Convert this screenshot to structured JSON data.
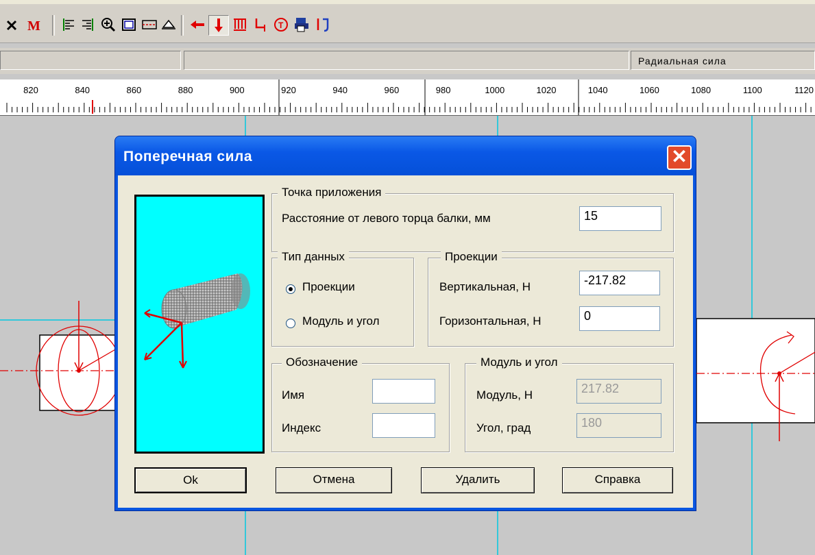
{
  "toolbar": {
    "icons": [
      "close-x-icon",
      "m-icon",
      "align-left-icon",
      "align-right-icon",
      "zoom-in-icon",
      "rectangle-icon",
      "section-icon",
      "support-icon",
      "arrow-left-icon",
      "arrow-down-icon",
      "distributed-load-icon",
      "step-icon",
      "torque-icon",
      "printer-icon",
      "moment-icon"
    ]
  },
  "status": {
    "field3": "Радиальная сила"
  },
  "ruler": {
    "ticks": [
      "820",
      "840",
      "860",
      "880",
      "900",
      "920",
      "940",
      "960",
      "980",
      "1000",
      "1020",
      "1040",
      "1060",
      "1080",
      "1100",
      "1120"
    ]
  },
  "dialog": {
    "title": "Поперечная сила",
    "close_label": "✕",
    "point_group": {
      "legend": "Точка приложения",
      "distance_label": "Расстояние от левого торца балки, мм",
      "distance_value": "15"
    },
    "datatype_group": {
      "legend": "Тип данных",
      "option_projections": "Проекции",
      "option_module": "Модуль и угол",
      "selected": "Проекции"
    },
    "projections_group": {
      "legend": "Проекции",
      "vertical_label": "Вертикальная, Н",
      "vertical_value": "-217.82",
      "horizontal_label": "Горизонтальная, Н",
      "horizontal_value": "0"
    },
    "designation_group": {
      "legend": "Обозначение",
      "name_label": "Имя",
      "name_value": "",
      "index_label": "Индекс",
      "index_value": ""
    },
    "module_group": {
      "legend": "Модуль и угол",
      "module_label": "Модуль, Н",
      "module_value": "217.82",
      "angle_label": "Угол, град",
      "angle_value": "180"
    },
    "buttons": {
      "ok": "Ok",
      "cancel": "Отмена",
      "delete": "Удалить",
      "help": "Справка"
    }
  },
  "colors": {
    "title_blue": "#0a56e0",
    "preview_bg": "#00ffff",
    "accent_red": "#e00000"
  }
}
